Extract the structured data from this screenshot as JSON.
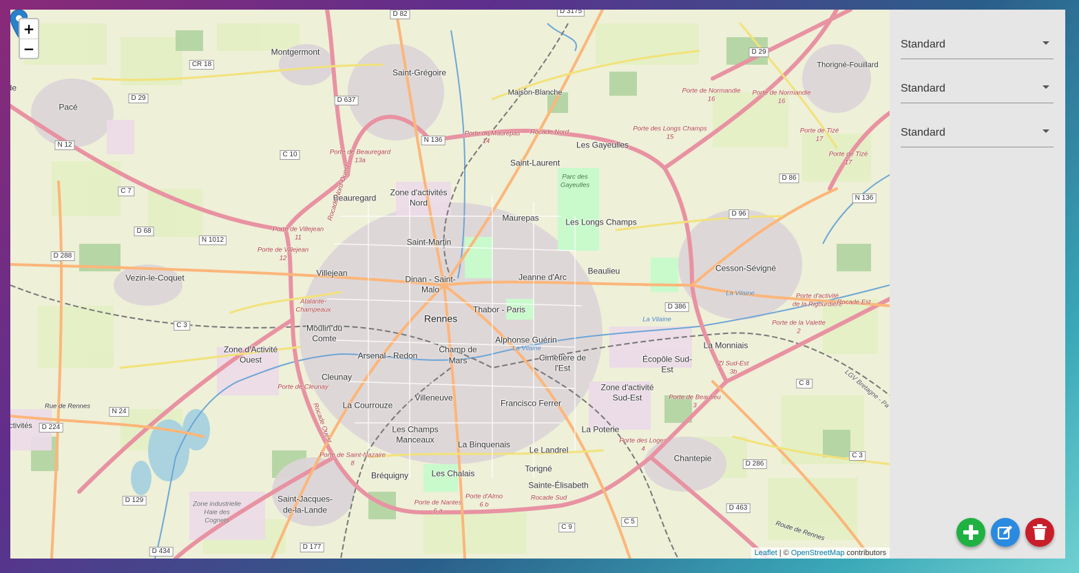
{
  "map": {
    "zoom_in_label": "+",
    "zoom_out_label": "−",
    "attribution": {
      "leaflet": "Leaflet",
      "separator": "| ©",
      "osm": "OpenStreetMap",
      "contributors": "contributors"
    },
    "places": {
      "rennes": "Rennes",
      "montgermont": "Montgermont",
      "pace": "Pacé",
      "saint_gregoire": "Saint-Grégoire",
      "maison_blanche": "Maison-Blanche",
      "thorigne": "Thorigné-Fouillard",
      "les_gayeulles": "Les Gayeulles",
      "saint_laurent": "Saint-Laurent",
      "zone_nord_1": "Zone d'activités",
      "zone_nord_2": "Nord",
      "beauregard": "Beauregard",
      "maurepas": "Maurepas",
      "les_longs_champs": "Les Longs Champs",
      "saint_martin": "Saint-Martin",
      "villejean": "Villejean",
      "vezin": "Vezin-le-Coquet",
      "dinan_1": "Dinan - Saint-",
      "dinan_2": "Malo",
      "jeanne_darc": "Jeanne d'Arc",
      "beaulieu": "Beaulieu",
      "cesson": "Cesson-Sévigné",
      "thabor": "Thabor - Paris",
      "moulin_1": "Moulin du",
      "moulin_2": "Comte",
      "zone_ouest_1": "Zone d'Activité",
      "zone_ouest_2": "Ouest",
      "arsenal": "Arsenal - Redon",
      "champ_1": "Champ de",
      "champ_2": "Mars",
      "alphonse": "Alphonse Guérin",
      "cimetiere_1": "Cimetière de",
      "cimetiere_2": "l'Est",
      "ecopole_1": "Écopôle Sud-",
      "ecopole_2": "Est",
      "la_monniais": "La Monniais",
      "cleunay": "Cleunay",
      "villeneuve": "Villeneuve",
      "zone_se_1": "Zone d'activité",
      "zone_se_2": "Sud-Est",
      "la_courrouze": "La Courrouze",
      "francisco": "Francisco Ferrer",
      "les_champs_1": "Les Champs",
      "les_champs_2": "Manceaux",
      "la_poterie": "La Poterie",
      "la_binquenais": "La Binquenais",
      "le_landrel": "Le Landrel",
      "chantepie": "Chantepie",
      "brequigny": "Bréquigny",
      "les_chalais": "Les Chalais",
      "torigne": "Torigné",
      "sainte_elisabeth": "Sainte-Élisabeth",
      "sjdll_1": "Saint-Jacques-",
      "sjdll_2": "de-la-Lande",
      "ile_de": "le de",
      "activites": "activités"
    },
    "roads": {
      "d82": "D 82",
      "d3175": "D 3175",
      "cr18": "CR 18",
      "d29a": "D 29",
      "d637": "D 637",
      "d29b": "D 29",
      "n12": "N 12",
      "n136a": "N 136",
      "c10": "C 10",
      "c7": "C 7",
      "d68": "D 68",
      "n1012": "N 1012",
      "d288": "D 288",
      "d86": "D 86",
      "n136b": "N 136",
      "d96": "D 96",
      "d386": "D 386",
      "c3a": "C 3",
      "c8": "C 8",
      "n24": "N 24",
      "d224": "D 224",
      "c3b": "C 3",
      "d286": "D 286",
      "d129": "D 129",
      "d463": "D 463",
      "c9": "C 9",
      "c5": "C 5",
      "d434": "D 434",
      "d177": "D 177"
    },
    "exits": {
      "normandie_1": "Porte de Normandie",
      "normandie_1n": "16",
      "normandie_2": "Porte de Normandie",
      "normandie_2n": "16",
      "maurepas": "Porte de Maurepas",
      "maurepas_n": "14",
      "rocade_nord": "Rocade Nord",
      "longs_champs": "Porte des Longs Champs",
      "longs_champs_n": "15",
      "tize_1": "Porte de Tizé",
      "tize_1n": "17",
      "tize_2": "Porte de Tizé",
      "tize_2n": "17",
      "beauregard": "Porte de Beauregard",
      "beauregard_n": "13a",
      "villejean_1": "Porte de Villejean",
      "villejean_1n": "11",
      "villejean_2": "Porte de Villejean",
      "villejean_2n": "12",
      "atalante_1": "Atalante-",
      "atalante_2": "Champeaux",
      "rigourdiere_1": "Porte d'activité",
      "rigourdiere_2": "de la Rigourdière",
      "valette": "Porte de la Valette",
      "valette_n": "2",
      "zi_sud_est": "ZI Sud-Est",
      "zi_n": "3b",
      "cleunay": "Porte de Cleunay",
      "beaulieu": "Porte de Beaulieu",
      "beaulieu_n": "3",
      "loges": "Porte des Loges",
      "loges_n": "4",
      "saint_nazaire": "Porte de Saint-Nazaire",
      "saint_nazaire_n": "8",
      "almo": "Porte d'Almo",
      "almo_n": "6 b",
      "nantes": "Porte de Nantes",
      "nantes_n": "6 a",
      "rocade_sud": "Rocade Sud",
      "rocade_est": "Rocade Est",
      "rocade_nord_ouest": "Rocade Nord-Ouest",
      "rocade_ouest": "Rocade Ouest",
      "rue_de_rennes": "Rue de Rennes",
      "route_de_rennes": "Route de Rennes",
      "lgv": "LGV Bretagne - Pa"
    },
    "parks": {
      "gayeulles_1": "Parc des",
      "gayeulles_2": "Gayeulles",
      "haie_1": "Zone industrielle",
      "haie_2": "Haie des",
      "haie_3": "Cognets",
      "la_vilaine_1": "La Vilaine",
      "la_vilaine_2": "La Vilaine",
      "la_vilaine_3": "La Vilaine"
    }
  },
  "panel": {
    "selects": [
      {
        "value": "Standard"
      },
      {
        "value": "Standard"
      },
      {
        "value": "Standard"
      }
    ]
  },
  "actions": {
    "add_color": "#1fb142",
    "edit_color": "#2a8ae0",
    "delete_color": "#c81e2a"
  },
  "colors": {
    "marker": "#2a81cb",
    "motorway": "#e892a2",
    "primary": "#fcd6a4",
    "secondary": "#f7fabf",
    "park": "#c8facc",
    "water": "#aad3df"
  }
}
